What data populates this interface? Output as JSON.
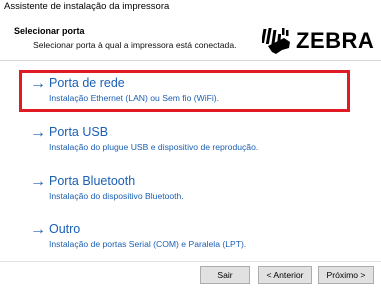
{
  "window": {
    "title": "Assistente de instalação da impressora"
  },
  "header": {
    "title": "Selecionar porta",
    "subtitle": "Selecionar porta à qual a impressora está conectada.",
    "logo_text": "ZEBRA"
  },
  "options": [
    {
      "title": "Porta de rede",
      "description": "Instalação Ethernet (LAN) ou Sem fio (WiFi).",
      "icon": "arrow-right-icon"
    },
    {
      "title": "Porta USB",
      "description": "Instalação do plugue USB e dispositivo de reprodução.",
      "icon": "arrow-right-icon"
    },
    {
      "title": "Porta Bluetooth",
      "description": "Instalação do dispositivo Bluetooth.",
      "icon": "arrow-right-icon"
    },
    {
      "title": "Outro",
      "description": "Instalação de portas Serial (COM) e Paralela (LPT).",
      "icon": "arrow-right-icon"
    }
  ],
  "buttons": {
    "exit": "Sair",
    "back": "< Anterior",
    "next": "Próximo >"
  },
  "colors": {
    "link": "#1a5fb4",
    "highlight": "#e01b24"
  }
}
